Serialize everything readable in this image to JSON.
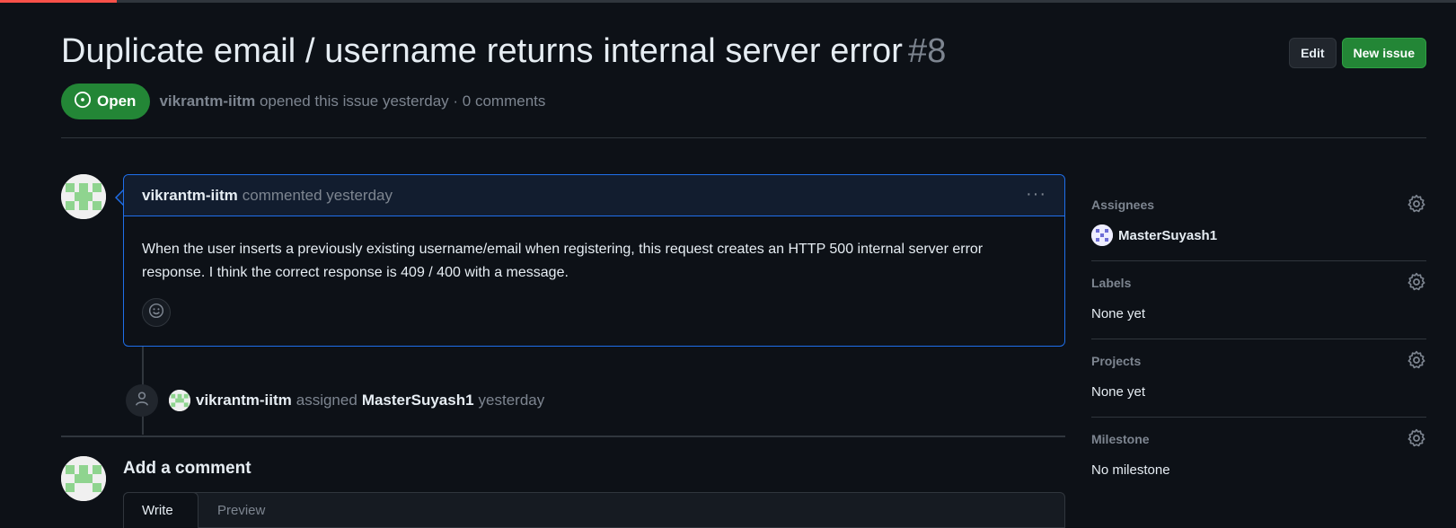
{
  "issue": {
    "title": "Duplicate email / username returns internal server error",
    "number": "#8",
    "state": "Open",
    "author": "vikrantm-iitm",
    "opened_text": "opened this issue yesterday · 0 comments"
  },
  "header_actions": {
    "edit_label": "Edit",
    "new_issue_label": "New issue"
  },
  "comment": {
    "author": "vikrantm-iitm",
    "action_text": "commented yesterday",
    "menu_label": "···",
    "body": "When the user inserts a previously existing username/email when registering, this request creates an HTTP 500 internal server error response. I think the correct response is 409 / 400 with a message."
  },
  "event": {
    "actor": "vikrantm-iitm",
    "verb": "assigned",
    "target": "MasterSuyash1",
    "time": "yesterday"
  },
  "add_comment": {
    "title": "Add a comment",
    "tab_write": "Write",
    "tab_preview": "Preview"
  },
  "sidebar": {
    "assignees": {
      "label": "Assignees",
      "value": "MasterSuyash1"
    },
    "labels": {
      "label": "Labels",
      "value": "None yet"
    },
    "projects": {
      "label": "Projects",
      "value": "None yet"
    },
    "milestone": {
      "label": "Milestone",
      "value": "No milestone"
    }
  },
  "colors": {
    "background": "#0d1117",
    "accent_blue": "#1f6feb",
    "open_green": "#238636",
    "muted": "#7d8590"
  },
  "icons": {
    "open_state": "issue-opened-icon",
    "kebab": "kebab-horizontal-icon",
    "smiley": "smiley-icon",
    "person": "person-icon",
    "gear": "gear-icon"
  }
}
